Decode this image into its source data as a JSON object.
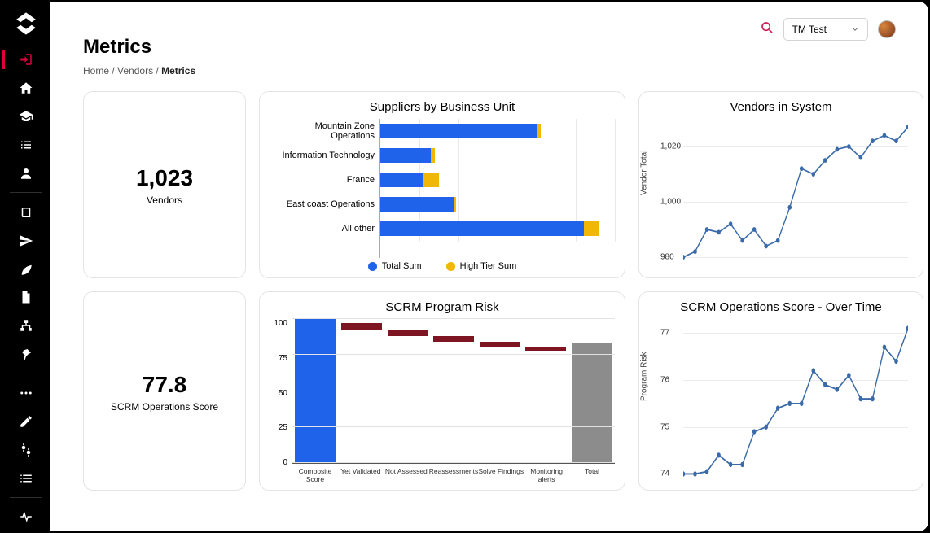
{
  "colors": {
    "blue": "#1e63e9",
    "yellow": "#f2b705",
    "maroon": "#7e1522",
    "gray": "#8c8c8c",
    "accent": "#e2003c"
  },
  "header": {
    "dropdown_label": "TM Test"
  },
  "page": {
    "title": "Metrics",
    "breadcrumb": {
      "home": "Home",
      "vendors": "Vendors",
      "current": "Metrics"
    }
  },
  "cards": {
    "vendors_count": {
      "value": "1,023",
      "label": "Vendors"
    },
    "scrm_score": {
      "value": "77.8",
      "label": "SCRM Operations Score"
    },
    "suppliers_bu": {
      "title": "Suppliers by Business Unit",
      "legend_total": "Total Sum",
      "legend_high": "High Tier Sum"
    },
    "scrm_risk": {
      "title": "SCRM Program Risk"
    },
    "vendors_sys": {
      "title": "Vendors in System",
      "ylabel": "Vendor Total"
    },
    "scrm_time": {
      "title": "SCRM Operations Score - Over Time",
      "ylabel": "Program Risk"
    }
  },
  "chart_data": [
    {
      "id": "suppliers_bu",
      "type": "bar",
      "orientation": "horizontal",
      "categories": [
        "Mountain Zone Operations",
        "Information Technology",
        "France",
        "East coast Operations",
        "All other"
      ],
      "series": [
        {
          "name": "Total Sum",
          "values": [
            200,
            65,
            55,
            95,
            260
          ]
        },
        {
          "name": "High Tier Sum",
          "values": [
            5,
            5,
            20,
            2,
            20
          ]
        }
      ],
      "xlim": [
        0,
        300
      ]
    },
    {
      "id": "vendors_sys",
      "type": "line",
      "ylabel": "Vendor Total",
      "yticks": [
        980,
        1000,
        1020
      ],
      "ylim": [
        975,
        1030
      ],
      "x": [
        0,
        1,
        2,
        3,
        4,
        5,
        6,
        7,
        8,
        9,
        10,
        11,
        12,
        13,
        14,
        15,
        16,
        17,
        18,
        19
      ],
      "values": [
        980,
        982,
        990,
        989,
        992,
        986,
        990,
        984,
        986,
        998,
        1012,
        1010,
        1015,
        1019,
        1020,
        1016,
        1022,
        1024,
        1022,
        1027
      ]
    },
    {
      "id": "scrm_risk",
      "type": "waterfall",
      "yticks": [
        0,
        25,
        50,
        75,
        100
      ],
      "ylim": [
        0,
        100
      ],
      "categories": [
        "Composite Score",
        "Yet Validated",
        "Not Assessed",
        "Reassessments",
        "Solve Findings",
        "Monitoring alerts",
        "Total"
      ],
      "bars": [
        {
          "top": 100,
          "bottom": 0,
          "color": "#1e63e9"
        },
        {
          "top": 97,
          "bottom": 92,
          "color": "#7e1522"
        },
        {
          "top": 92,
          "bottom": 88,
          "color": "#7e1522"
        },
        {
          "top": 88,
          "bottom": 84,
          "color": "#7e1522"
        },
        {
          "top": 84,
          "bottom": 80,
          "color": "#7e1522"
        },
        {
          "top": 80,
          "bottom": 78,
          "color": "#7e1522"
        },
        {
          "top": 83,
          "bottom": 0,
          "color": "#8c8c8c"
        }
      ]
    },
    {
      "id": "scrm_time",
      "type": "line",
      "ylabel": "Program Risk",
      "yticks": [
        74,
        75,
        76,
        77
      ],
      "ylim": [
        73.8,
        77.3
      ],
      "x": [
        0,
        1,
        2,
        3,
        4,
        5,
        6,
        7,
        8,
        9,
        10,
        11,
        12,
        13,
        14,
        15,
        16,
        17,
        18,
        19
      ],
      "values": [
        74.0,
        74.0,
        74.05,
        74.4,
        74.2,
        74.2,
        74.9,
        75.0,
        75.4,
        75.5,
        75.5,
        76.2,
        75.9,
        75.8,
        76.1,
        75.6,
        75.6,
        76.7,
        76.4,
        77.1
      ]
    }
  ]
}
